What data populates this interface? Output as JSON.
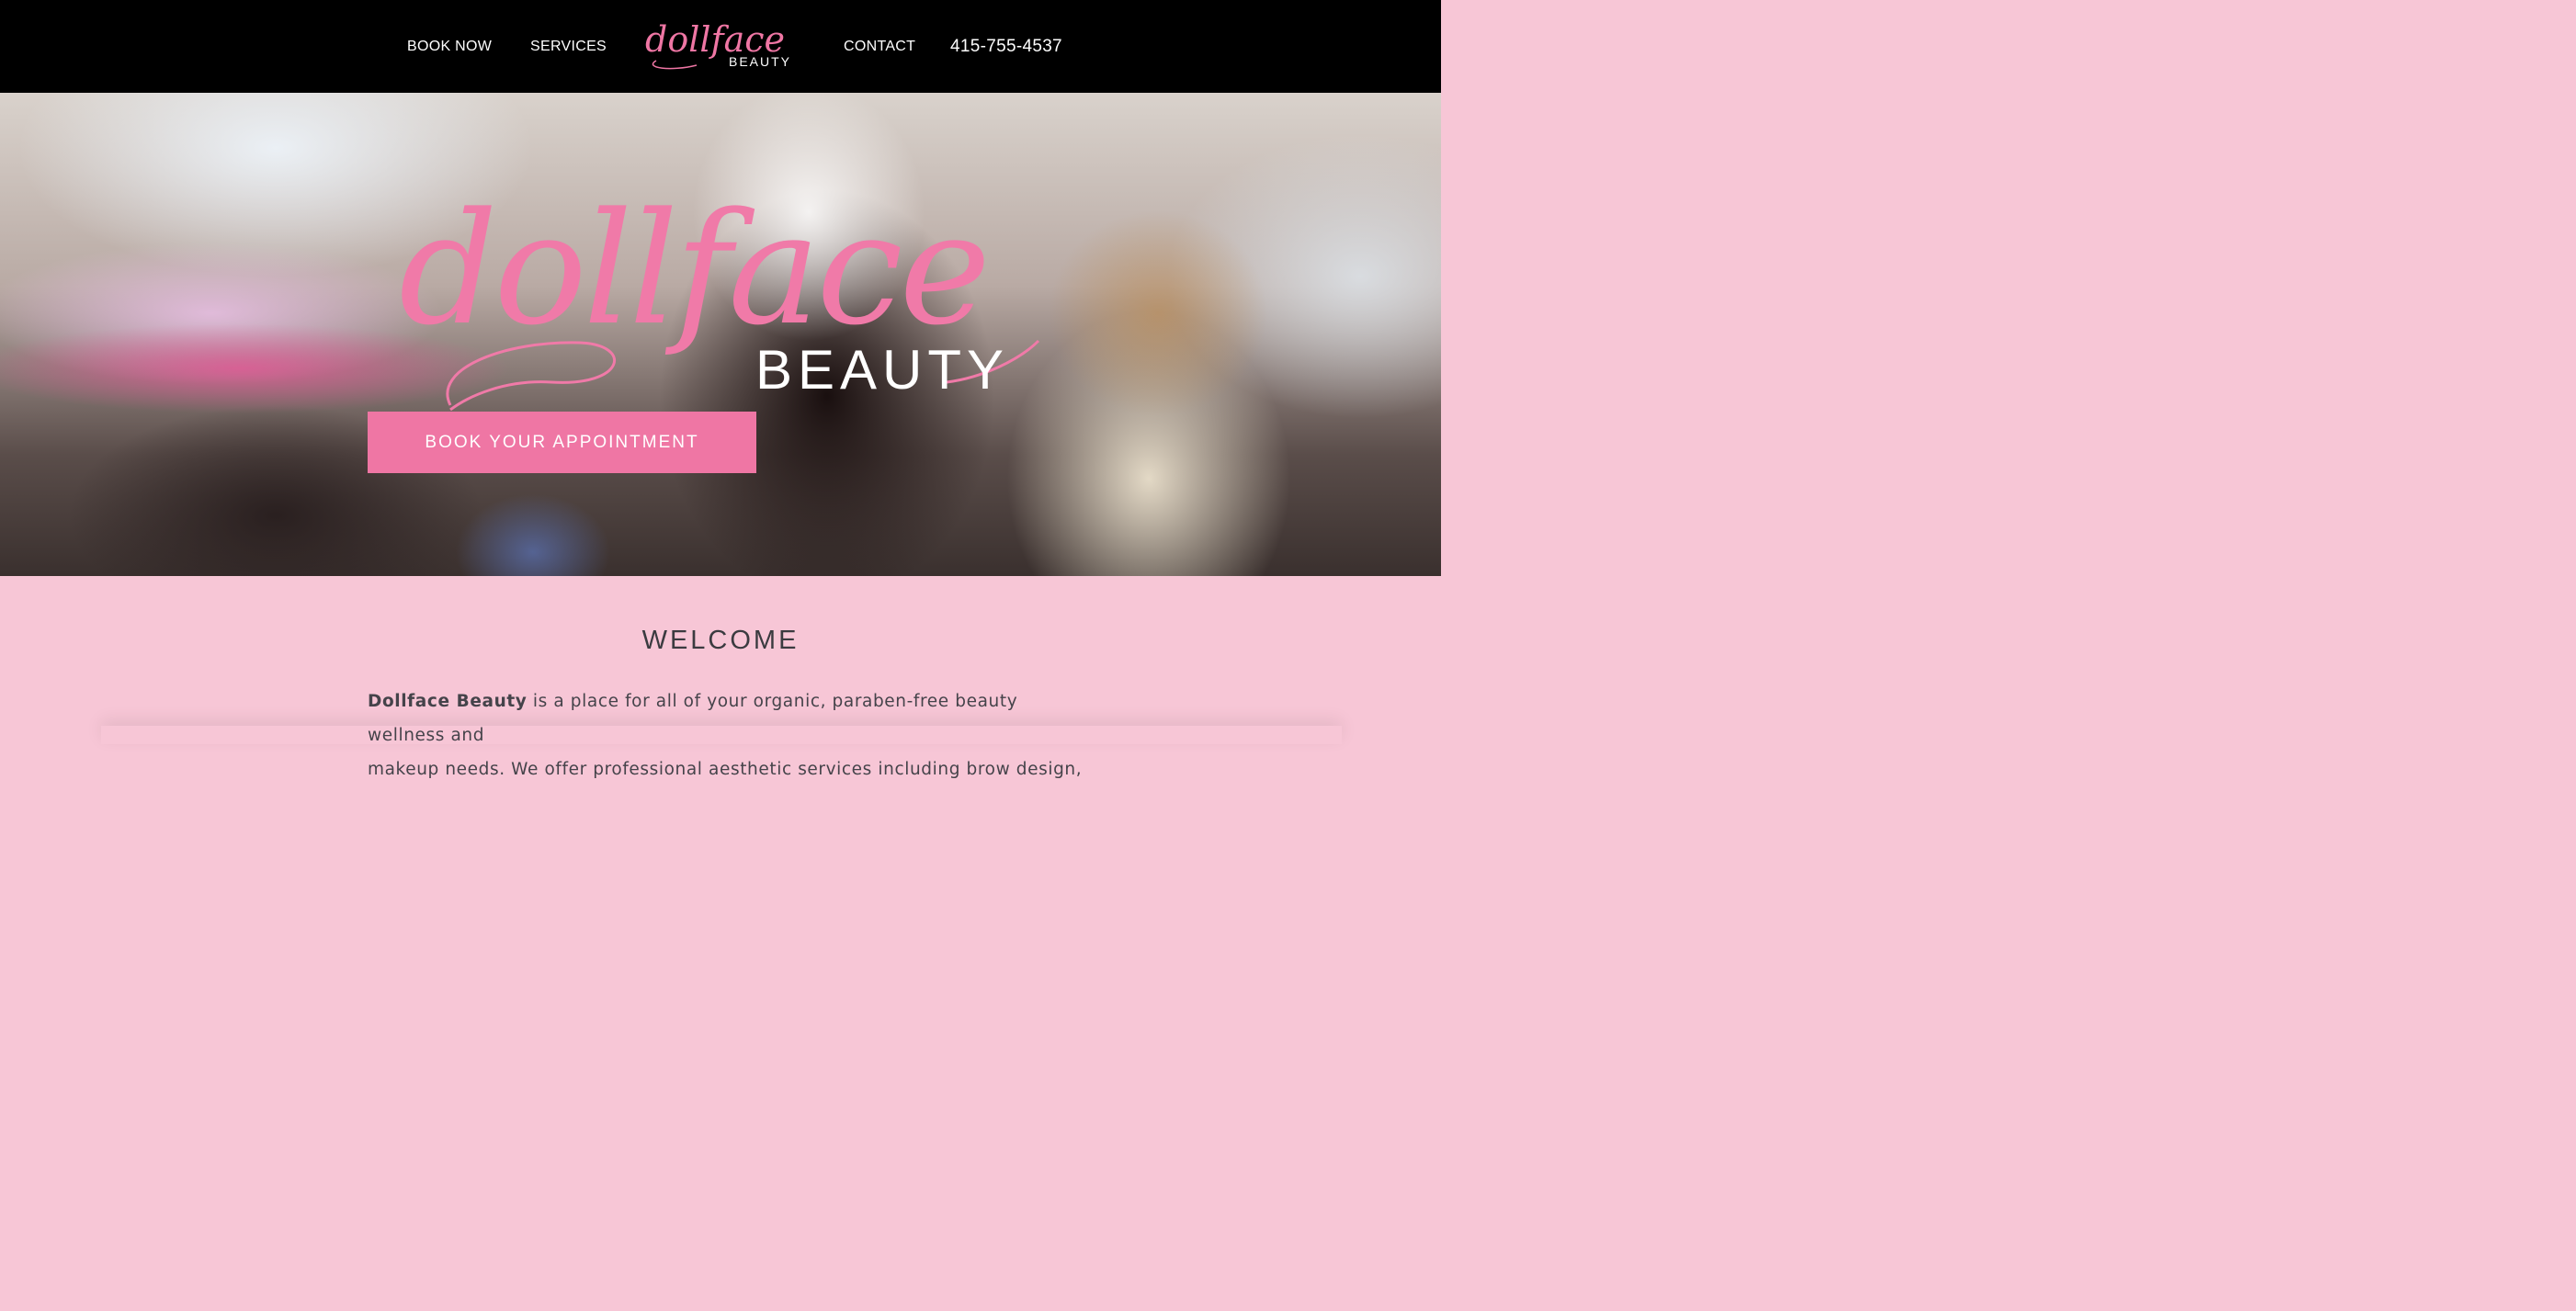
{
  "nav": {
    "book_now": "BOOK NOW",
    "services": "SERVICES",
    "contact": "CONTACT",
    "phone": "415-755-4537"
  },
  "logo": {
    "script": "dollface",
    "word": "BEAUTY"
  },
  "hero": {
    "logo_script": "dollface",
    "logo_word": "BEAUTY",
    "cta_label": "BOOK YOUR APPOINTMENT"
  },
  "welcome": {
    "heading": "WELCOME",
    "brand": "Dollface Beauty",
    "line1_rest": " is a place for all of your organic, paraben-free beauty wellness and",
    "line2": "makeup needs. We offer professional aesthetic services including brow design,"
  },
  "colors": {
    "accent_pink": "#ef76a4",
    "section_pink": "#f7c6d6",
    "nav_bg": "#000000"
  }
}
